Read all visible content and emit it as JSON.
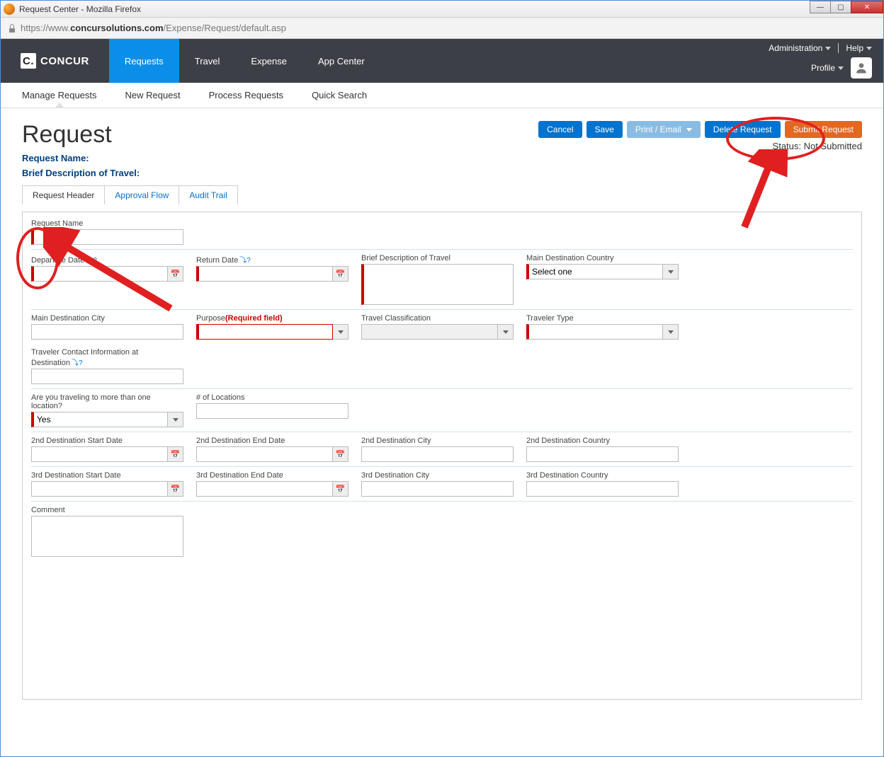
{
  "window": {
    "title": "Request Center - Mozilla Firefox"
  },
  "url": {
    "proto": "https://www.",
    "host": "concursolutions.com",
    "path": "/Expense/Request/default.asp"
  },
  "brand": "CONCUR",
  "nav": {
    "items": [
      "Requests",
      "Travel",
      "Expense",
      "App Center"
    ],
    "active": "Requests"
  },
  "nav_right": {
    "admin": "Administration",
    "help": "Help",
    "profile": "Profile"
  },
  "subnav": {
    "items": [
      "Manage Requests",
      "New Request",
      "Process Requests",
      "Quick Search"
    ],
    "active": "Manage Requests"
  },
  "page": {
    "title": "Request",
    "buttons": {
      "cancel": "Cancel",
      "save": "Save",
      "print": "Print / Email",
      "del": "Delete Request",
      "submit": "Submit Request"
    },
    "status_label": "Status:",
    "status_value": "Not Submitted",
    "meta1": "Request Name:",
    "meta2": "Brief Description of Travel:"
  },
  "tabs": {
    "items": [
      "Request Header",
      "Approval Flow",
      "Audit Trail"
    ],
    "active": "Request Header"
  },
  "form": {
    "request_name": {
      "label": "Request Name",
      "value": ""
    },
    "departure_date": {
      "label": "Departure Date",
      "value": ""
    },
    "return_date": {
      "label": "Return Date",
      "value": ""
    },
    "brief_desc": {
      "label": "Brief Description of Travel",
      "value": ""
    },
    "main_dest_country": {
      "label": "Main Destination Country",
      "value": "Select one"
    },
    "main_dest_city": {
      "label": "Main Destination City",
      "value": ""
    },
    "purpose": {
      "label": "Purpose",
      "note": "(Required field)",
      "value": ""
    },
    "travel_class": {
      "label": "Travel Classification",
      "value": ""
    },
    "traveler_type": {
      "label": "Traveler Type",
      "value": ""
    },
    "contact_info": {
      "label": "Traveler Contact Information at Destination",
      "value": ""
    },
    "multi_loc": {
      "label": "Are you traveling to more than one location?",
      "value": "Yes"
    },
    "num_loc": {
      "label": "# of Locations",
      "value": ""
    },
    "d2_start": {
      "label": "2nd Destination Start Date",
      "value": ""
    },
    "d2_end": {
      "label": "2nd Destination End Date",
      "value": ""
    },
    "d2_city": {
      "label": "2nd Destination City",
      "value": ""
    },
    "d2_country": {
      "label": "2nd Destination Country",
      "value": ""
    },
    "d3_start": {
      "label": "3rd Destination Start Date",
      "value": ""
    },
    "d3_end": {
      "label": "3rd Destination End Date",
      "value": ""
    },
    "d3_city": {
      "label": "3rd Destination City",
      "value": ""
    },
    "d3_country": {
      "label": "3rd Destination Country",
      "value": ""
    },
    "comment": {
      "label": "Comment",
      "value": ""
    }
  },
  "help_icon": "⤵?"
}
